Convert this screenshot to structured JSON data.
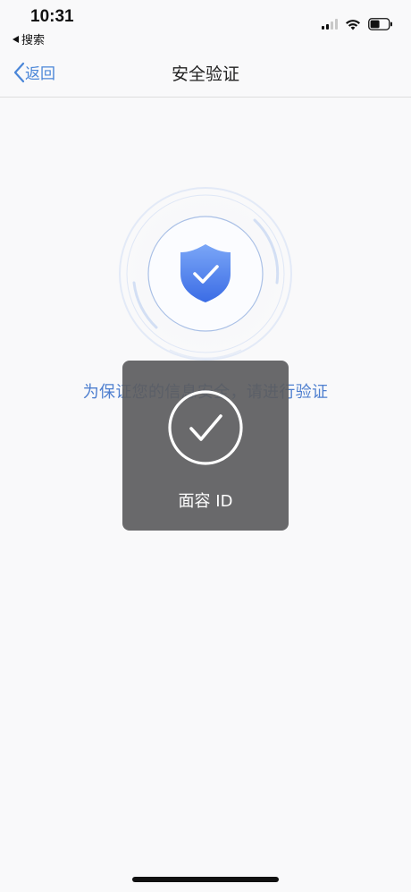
{
  "status_bar": {
    "time": "10:31",
    "back_app": "搜索",
    "signal_icon": "cellular-signal-icon",
    "wifi_icon": "wifi-icon",
    "battery_icon": "battery-icon"
  },
  "nav": {
    "back_label": "返回",
    "back_icon": "chevron-left-icon",
    "title": "安全验证"
  },
  "main": {
    "shield_icon": "shield-check-icon",
    "verify_prompt": "为保证您的信息安全，请进行验证"
  },
  "faceid_popup": {
    "icon": "checkmark-circle-icon",
    "label": "面容 ID"
  },
  "colors": {
    "accent": "#4a86d8",
    "shield_top": "#6f9ef5",
    "shield_bottom": "#3d6fe6",
    "overlay": "#5c5c5e"
  }
}
